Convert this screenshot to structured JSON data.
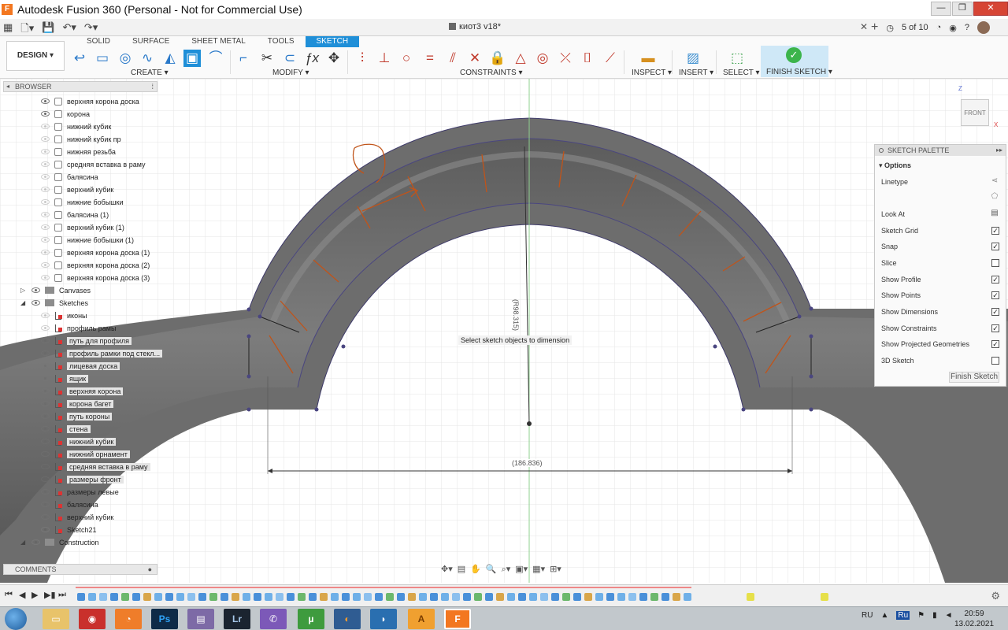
{
  "window": {
    "title": "Autodesk Fusion 360 (Personal - Not for Commercial Use)",
    "logo_letter": "F",
    "minimize": "—",
    "maximize": "❐",
    "close": "✕"
  },
  "tabbar": {
    "doc_title": "киот3 v18*",
    "close": "✕",
    "new_tab": "+",
    "page_indicator": "5 of 10"
  },
  "ribbon": {
    "workspace": "DESIGN ▾",
    "tabs": [
      "SOLID",
      "SURFACE",
      "SHEET METAL",
      "TOOLS",
      "SKETCH"
    ],
    "groups": {
      "create": "CREATE ▾",
      "modify": "MODIFY ▾",
      "constraints": "CONSTRAINTS ▾",
      "inspect": "INSPECT ▾",
      "insert": "INSERT ▾",
      "select": "SELECT ▾",
      "finish": "FINISH SKETCH ▾"
    },
    "accent_color": "#1f8fd8",
    "finish_color": "#3cb44b"
  },
  "browser": {
    "header": "BROWSER",
    "items": [
      {
        "label": "верхняя корона доска",
        "type": "body"
      },
      {
        "label": "корона",
        "type": "body"
      },
      {
        "label": "нижний кубик",
        "type": "body"
      },
      {
        "label": "нижний кубик пр",
        "type": "body"
      },
      {
        "label": "нижняя резьба",
        "type": "body"
      },
      {
        "label": "средняя вставка в раму",
        "type": "body"
      },
      {
        "label": "балясина",
        "type": "body"
      },
      {
        "label": "верхний кубик",
        "type": "body"
      },
      {
        "label": "нижние бобышки",
        "type": "body"
      },
      {
        "label": "балясина (1)",
        "type": "body"
      },
      {
        "label": "верхний кубик (1)",
        "type": "body"
      },
      {
        "label": "нижние бобышки (1)",
        "type": "body"
      },
      {
        "label": "верхняя корона доска (1)",
        "type": "body"
      },
      {
        "label": "верхняя корона доска (2)",
        "type": "body"
      },
      {
        "label": "верхняя корона доска (3)",
        "type": "body"
      }
    ],
    "folders": {
      "canvases": "Canvases",
      "sketches": "Sketches",
      "construction": "Construction"
    },
    "sketches": [
      "иконы",
      "профиль рамы",
      "путь для профиля",
      "профиль рамки под стекл...",
      "лицевая доска",
      "ящик",
      "верхняя корона",
      "корона багет",
      "путь короны",
      "стена",
      "нижний кубик",
      "нижний орнамент",
      "средняя вставка в раму",
      "размеры фронт",
      "размеры левые",
      "балясина",
      "верхний кубик",
      "Sketch21"
    ]
  },
  "comments": {
    "header": "COMMENTS"
  },
  "canvas": {
    "tooltip": "Select sketch objects to dimension",
    "radius_dim": "(R98.315)",
    "width_dim": "(186.836)"
  },
  "viewcube": {
    "face": "FRONT",
    "z": "Z",
    "x": "X"
  },
  "palette": {
    "header": "SKETCH PALETTE",
    "section": "Options",
    "options": [
      {
        "label": "Linetype",
        "kind": "icon",
        "icon": "construction-line-icon"
      },
      {
        "label": "",
        "kind": "icon",
        "icon": "centerline-icon"
      },
      {
        "label": "Look At",
        "kind": "icon",
        "icon": "look-at-icon"
      },
      {
        "label": "Sketch Grid",
        "kind": "check",
        "checked": true
      },
      {
        "label": "Snap",
        "kind": "check",
        "checked": true
      },
      {
        "label": "Slice",
        "kind": "check",
        "checked": false
      },
      {
        "label": "Show Profile",
        "kind": "check",
        "checked": true
      },
      {
        "label": "Show Points",
        "kind": "check",
        "checked": true
      },
      {
        "label": "Show Dimensions",
        "kind": "check",
        "checked": true
      },
      {
        "label": "Show Constraints",
        "kind": "check",
        "checked": true
      },
      {
        "label": "Show Projected Geometries",
        "kind": "check",
        "checked": true
      },
      {
        "label": "3D Sketch",
        "kind": "check",
        "checked": false
      }
    ],
    "finish_button": "Finish Sketch"
  },
  "taskbar": {
    "language": "RU",
    "time": "20:59",
    "date": "13.02.2021",
    "apps": [
      "Ps",
      "Lr",
      "A",
      "F"
    ]
  }
}
